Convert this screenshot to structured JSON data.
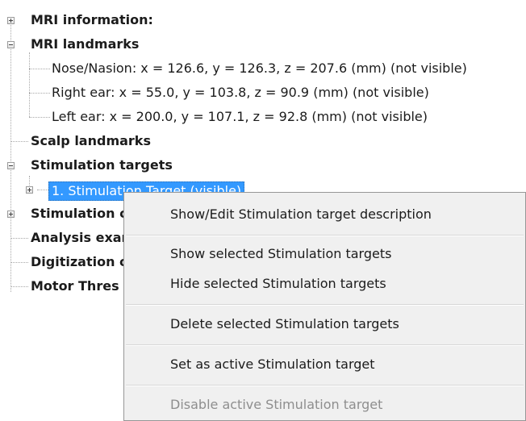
{
  "tree": {
    "mri_information": "MRI information:",
    "mri_landmarks": "MRI landmarks",
    "landmarks": [
      "Nose/Nasion: x = 126.6, y = 126.3, z = 207.6 (mm) (not visible)",
      "Right ear: x = 55.0, y = 103.8, z = 90.9 (mm) (not visible)",
      "Left ear: x = 200.0, y = 107.1, z = 92.8 (mm) (not visible)"
    ],
    "scalp_landmarks": "Scalp landmarks",
    "stimulation_targets": "Stimulation targets",
    "selected_target": "1. Stimulation Target (visible)",
    "stimulation_partial": "Stimulation c",
    "analysis_partial": "Analysis exar",
    "digitization_partial": "Digitization c",
    "motor_partial": "Motor Thres"
  },
  "context_menu": {
    "items": [
      "Show/Edit Stimulation target description",
      "Show selected Stimulation targets",
      "Hide selected Stimulation targets",
      "Delete selected Stimulation targets",
      "Set as active Stimulation target",
      "Disable active Stimulation target"
    ]
  },
  "colors": {
    "selection": "#3399ff",
    "menu_background": "#f0f0f0",
    "disabled_text": "#8e8e8e"
  }
}
